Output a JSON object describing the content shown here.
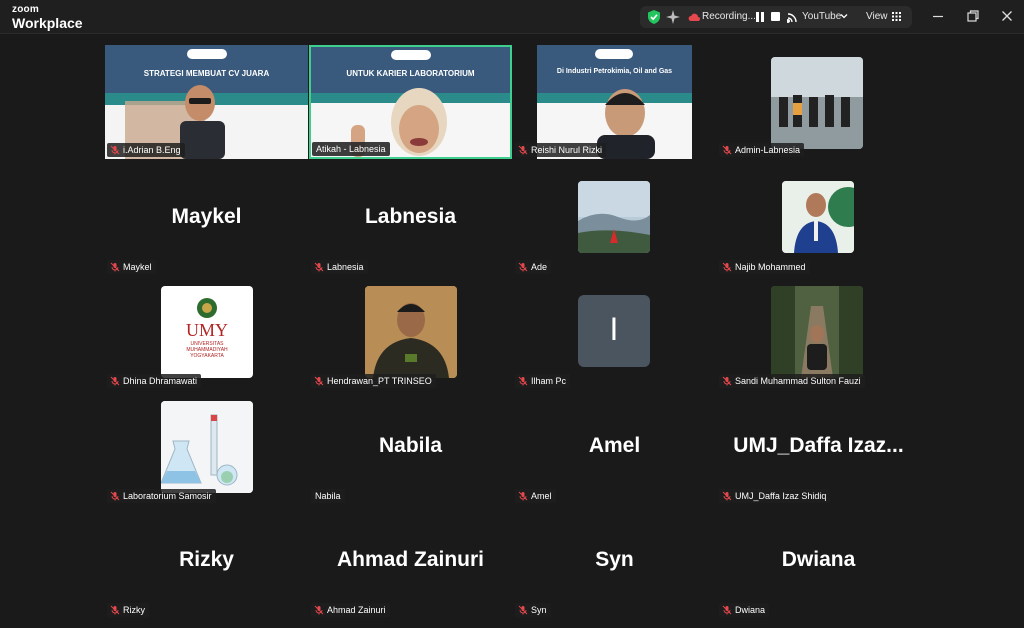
{
  "app": {
    "brand_top": "zoom",
    "brand_bottom": "Workplace"
  },
  "toolbar": {
    "recording_label": "Recording...",
    "stream_label": "YouTube",
    "view_label": "View"
  },
  "slide": {
    "pill": "WEBINAR NASIONAL",
    "title1": "STRATEGI MEMBUAT CV JUARA",
    "title2": "UNTUK KARIER LABORATORIUM",
    "sub": "Di Industri Petrokimia, Oil and Gas"
  },
  "participants": [
    {
      "name": "i.Adrian B.Eng"
    },
    {
      "name": "Atikah - Labnesia"
    },
    {
      "name": "Reishi Nurul Rizki"
    },
    {
      "name": "Admin-Labnesia"
    },
    {
      "name": "Maykel",
      "big": "Maykel"
    },
    {
      "name": "Labnesia",
      "big": "Labnesia"
    },
    {
      "name": "Ade"
    },
    {
      "name": "Najib Mohammed"
    },
    {
      "name": "Dhina Dhramawati",
      "logo_text": "UMY",
      "logo_sub1": "UNIVERSITAS",
      "logo_sub2": "MUHAMMADIYAH",
      "logo_sub3": "YOGYAKARTA"
    },
    {
      "name": "Hendrawan_PT TRINSEO"
    },
    {
      "name": "Ilham Pc",
      "initial": "I"
    },
    {
      "name": "Sandi Muhammad Sulton Fauzi"
    },
    {
      "name": "Laboratorium Samosir"
    },
    {
      "name": "Nabila",
      "big": "Nabila"
    },
    {
      "name": "Amel",
      "big": "Amel"
    },
    {
      "name": "UMJ_Daffa Izaz Shidiq",
      "big": "UMJ_Daffa  Izaz..."
    },
    {
      "name": "Rizky",
      "big": "Rizky"
    },
    {
      "name": "Ahmad Zainuri",
      "big": "Ahmad Zainuri"
    },
    {
      "name": "Syn",
      "big": "Syn"
    },
    {
      "name": "Dwiana",
      "big": "Dwiana"
    }
  ],
  "colors": {
    "active_speaker": "#3ecf8e",
    "muted_red": "#e5484d",
    "bg": "#1a1a1a"
  }
}
